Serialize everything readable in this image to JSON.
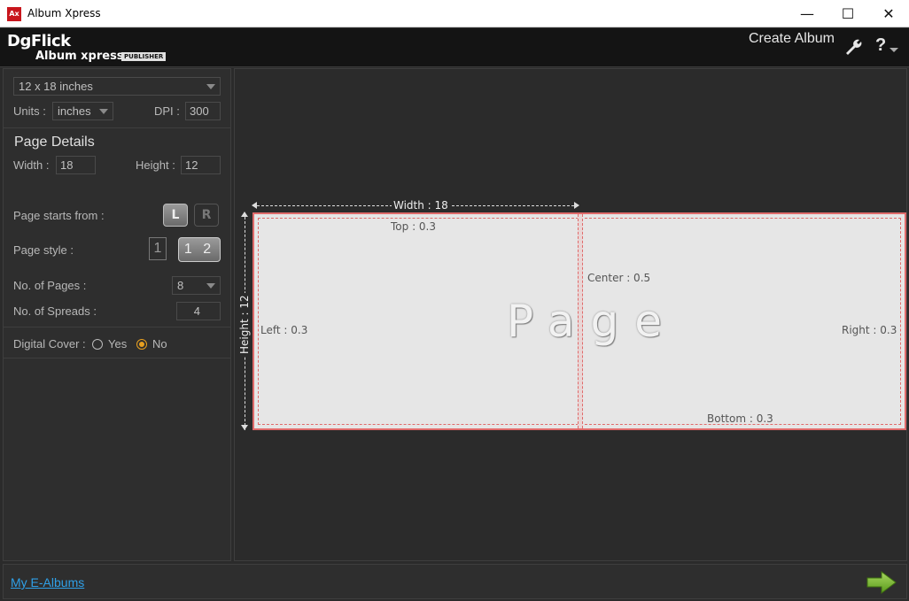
{
  "window": {
    "title": "Album Xpress",
    "app_icon_text": "Ax",
    "minimize": "—",
    "maximize": "☐",
    "close": "✕"
  },
  "header": {
    "logo_top": "DgFlick",
    "logo_sub": "Album xpress",
    "logo_badge": "PUBLISHER",
    "create_album_label": "Create Album",
    "help_label": "?"
  },
  "settings": {
    "size_select": "12 x 18 inches",
    "units_label": "Units :",
    "units_value": "inches",
    "dpi_label": "DPI :",
    "dpi_value": "300",
    "page_details_title": "Page Details",
    "width_label": "Width :",
    "width_value": "18",
    "height_label": "Height :",
    "height_value": "12",
    "page_starts_label": "Page starts from :",
    "start_left": "L",
    "start_right": "R",
    "page_style_label": "Page style :",
    "style_single": "1",
    "style_double": "1 2",
    "num_pages_label": "No. of Pages :",
    "num_pages_value": "8",
    "num_spreads_label": "No. of Spreads :",
    "num_spreads_value": "4",
    "digital_cover_label": "Digital Cover :",
    "cover_yes": "Yes",
    "cover_no": "No"
  },
  "canvas": {
    "width_dim": "Width : 18",
    "height_dim": "Height : 12",
    "top_margin": "Top : 0.3",
    "left_margin": "Left : 0.3",
    "center_margin": "Center : 0.5",
    "right_margin": "Right : 0.3",
    "bottom_margin": "Bottom : 0.3",
    "watermark": "Page"
  },
  "footer": {
    "my_albums_link": "My E-Albums"
  },
  "colors": {
    "accent_orange": "#e8a020",
    "brand_red": "#c8161d",
    "margin_red": "#e06a6a",
    "link_blue": "#2fa0e8",
    "next_green": "#7ab531"
  }
}
